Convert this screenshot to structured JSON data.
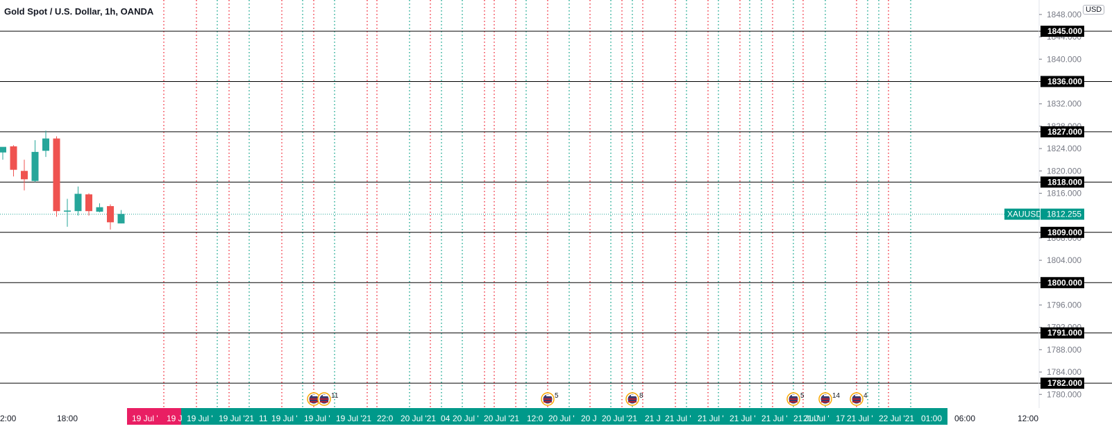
{
  "legend": {
    "symbol_title": "Gold Spot / U.S. Dollar, 1h, OANDA"
  },
  "currency": "USD",
  "colors": {
    "up": "#26a69a",
    "down": "#ef5350",
    "teal_band": "#00998a",
    "pink": "#e91e63",
    "red_line": "#f23645",
    "teal_line": "#22ab94",
    "hline": "#000000",
    "price_line": "#26a69a"
  },
  "price_axis": {
    "ticks": [
      {
        "v": 1848,
        "label": "1848.000"
      },
      {
        "v": 1844,
        "label": "1844.000"
      },
      {
        "v": 1840,
        "label": "1840.000"
      },
      {
        "v": 1836,
        "label": "1836.000"
      },
      {
        "v": 1832,
        "label": "1832.000"
      },
      {
        "v": 1828,
        "label": "1828.000"
      },
      {
        "v": 1824,
        "label": "1824.000"
      },
      {
        "v": 1820,
        "label": "1820.000"
      },
      {
        "v": 1816,
        "label": "1816.000"
      },
      {
        "v": 1808,
        "label": "1808.000"
      },
      {
        "v": 1804,
        "label": "1804.000"
      },
      {
        "v": 1796,
        "label": "1796.000"
      },
      {
        "v": 1792,
        "label": "1792.000"
      },
      {
        "v": 1788,
        "label": "1788.000"
      },
      {
        "v": 1784,
        "label": "1784.000"
      },
      {
        "v": 1780,
        "label": "1780.000"
      }
    ]
  },
  "horizontal_levels": [
    {
      "v": 1845,
      "label": "1845.000"
    },
    {
      "v": 1836,
      "label": "1836.000"
    },
    {
      "v": 1827,
      "label": "1827.000"
    },
    {
      "v": 1818,
      "label": "1818.000"
    },
    {
      "v": 1809,
      "label": "1809.000"
    },
    {
      "v": 1800,
      "label": "1800.000"
    },
    {
      "v": 1791,
      "label": "1791.000"
    },
    {
      "v": 1782,
      "label": "1782.000"
    }
  ],
  "current_price": {
    "symbol": "XAUUSD",
    "label": "1812.255",
    "v": 1812.255
  },
  "chart_data": {
    "type": "candlestick",
    "title": "Gold Spot / U.S. Dollar, 1h, OANDA",
    "ylim": [
      1778.4,
      1849.8
    ],
    "x_tick_labels": [
      "2:00",
      "18:00",
      "06:00",
      "12:00"
    ],
    "candles": [
      {
        "o": 1823.3,
        "h": 1824.0,
        "l": 1822.0,
        "c": 1824.3
      },
      {
        "o": 1824.4,
        "h": 1824.6,
        "l": 1819.0,
        "c": 1820.2
      },
      {
        "o": 1820.0,
        "h": 1822.0,
        "l": 1816.5,
        "c": 1818.5
      },
      {
        "o": 1818.2,
        "h": 1825.5,
        "l": 1818.0,
        "c": 1823.4
      },
      {
        "o": 1823.6,
        "h": 1827.2,
        "l": 1822.5,
        "c": 1825.8
      },
      {
        "o": 1825.8,
        "h": 1826.2,
        "l": 1811.8,
        "c": 1812.8
      },
      {
        "o": 1812.7,
        "h": 1815.0,
        "l": 1810.0,
        "c": 1812.9
      },
      {
        "o": 1812.8,
        "h": 1817.2,
        "l": 1812.0,
        "c": 1815.9
      },
      {
        "o": 1815.8,
        "h": 1816.0,
        "l": 1812.0,
        "c": 1812.8
      },
      {
        "o": 1812.7,
        "h": 1814.2,
        "l": 1812.6,
        "c": 1813.5
      },
      {
        "o": 1813.7,
        "h": 1814.0,
        "l": 1809.5,
        "c": 1810.8
      },
      {
        "o": 1810.6,
        "h": 1813.0,
        "l": 1810.6,
        "c": 1812.3
      }
    ]
  },
  "time_axis": {
    "band_labels": [
      {
        "text": "19 Jul '",
        "hl": true
      },
      {
        "text": "19 J",
        "hl": true
      },
      {
        "text": "19 Jul '"
      },
      {
        "text": "19 Jul '21"
      },
      {
        "text": "11"
      },
      {
        "text": "19 Jul '"
      },
      {
        "text": "19 Jul '"
      },
      {
        "text": "19 Jul '21"
      },
      {
        "text": "22:0"
      },
      {
        "text": "20 Jul '21"
      },
      {
        "text": "04"
      },
      {
        "text": "20 Jul '"
      },
      {
        "text": "20 Jul '21"
      },
      {
        "text": "12:0"
      },
      {
        "text": "20 Jul '"
      },
      {
        "text": "20 J"
      },
      {
        "text": "20 Jul '21"
      },
      {
        "text": "21 J"
      },
      {
        "text": "21 Jul '"
      },
      {
        "text": "21 Jul '"
      },
      {
        "text": "21 Jul '"
      },
      {
        "text": "21 Jul '"
      },
      {
        "text": "21 Jul '"
      },
      {
        "text": "21 Jul '"
      },
      {
        "text": "17"
      },
      {
        "text": "21 Jul '"
      },
      {
        "text": "22 Jul '21"
      },
      {
        "text": "01:00"
      }
    ]
  },
  "events": [
    {
      "count": ""
    },
    {
      "count": "11"
    },
    {
      "count": "5"
    },
    {
      "count": "8"
    },
    {
      "count": "5"
    },
    {
      "count": "14"
    },
    {
      "count": "4"
    }
  ]
}
